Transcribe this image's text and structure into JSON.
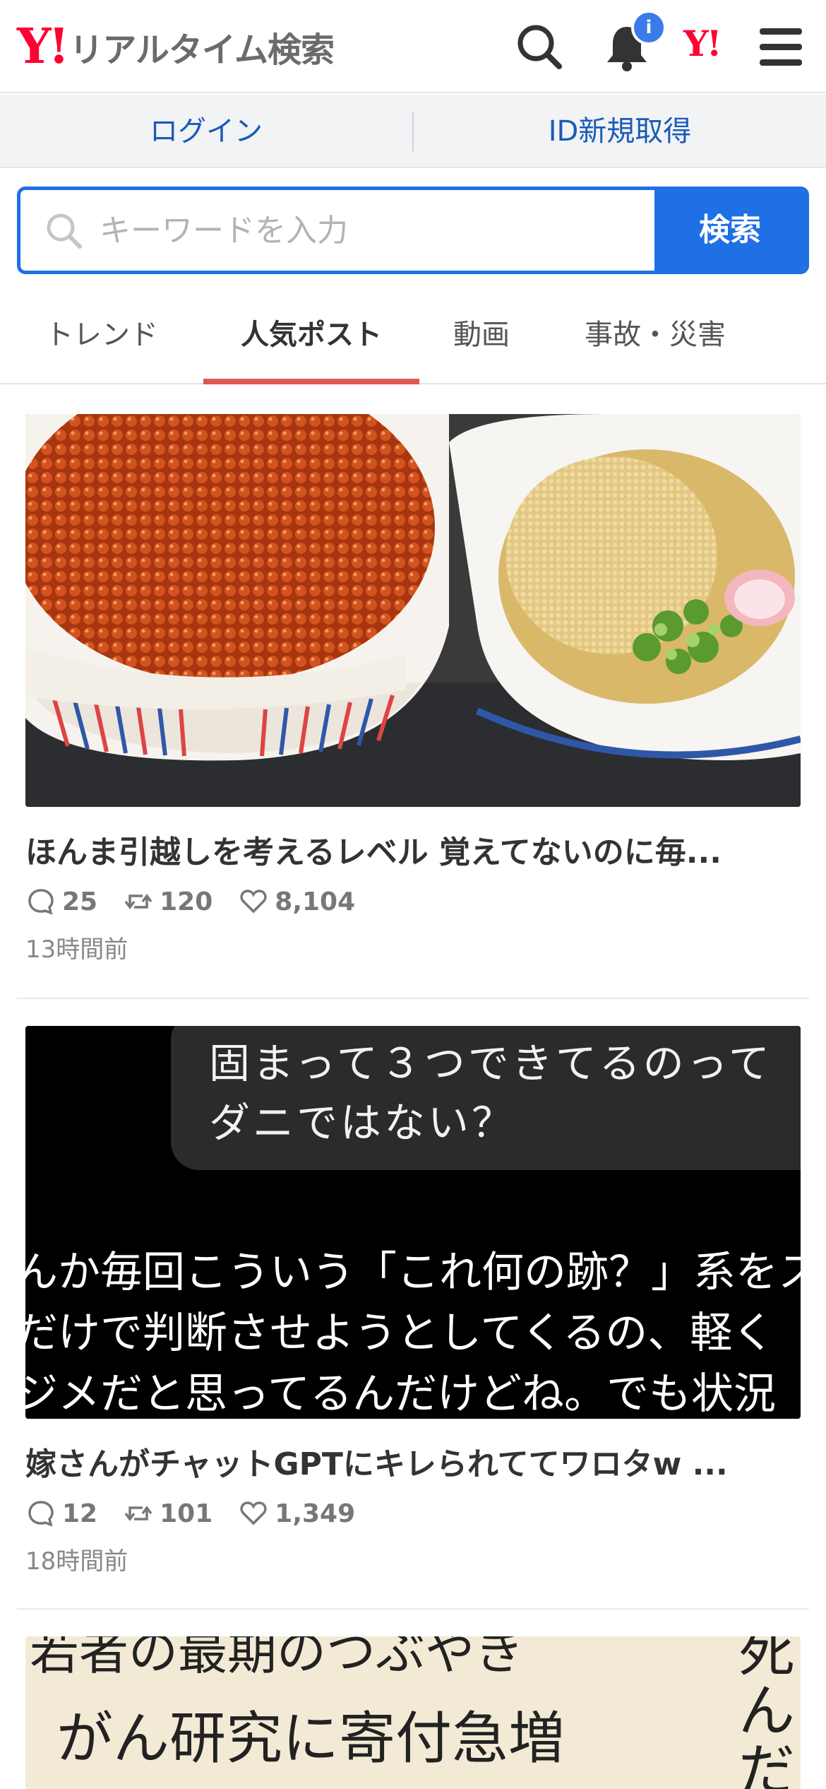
{
  "header": {
    "logo_mark": "Y!",
    "logo_text": "リアルタイム検索",
    "icons": [
      "search-icon",
      "bell-icon",
      "yahoo-logo-icon",
      "menu-icon"
    ],
    "notification_badge": "i",
    "small_logo": "Y!"
  },
  "loginbar": {
    "login_label": "ログイン",
    "signup_label": "ID新規取得"
  },
  "search": {
    "placeholder": "キーワードを入力",
    "value": "",
    "button_label": "検索"
  },
  "tabs": [
    {
      "label": "トレンド",
      "active": false
    },
    {
      "label": "人気ポスト",
      "active": true
    },
    {
      "label": "動画",
      "active": false
    },
    {
      "label": "事故・災害",
      "active": false
    }
  ],
  "posts": [
    {
      "title": "ほんま引越しを考えるレベル 覚えてないのに毎...",
      "replies": "25",
      "reposts": "120",
      "likes": "8,104",
      "time": "13時間前"
    },
    {
      "title": "嫁さんがチャットGPTにキレられててワロタw ...",
      "image_text": {
        "bubble_line1": "固まって３つできてるのって",
        "bubble_line2": "ダニではない？",
        "caption_line1": "んか毎回こういう「これ何の跡？」系をス",
        "caption_line2": "だけで判断させようとしてくるの、軽く",
        "caption_line3": "ジメだと思ってるんだけどね。でも状況"
      },
      "replies": "12",
      "reposts": "101",
      "likes": "1,349",
      "time": "18時間前"
    },
    {
      "image_text": {
        "line1": "若者の最期のつぶやき",
        "line2": "がん研究に寄付急増",
        "side": "死んだ"
      }
    }
  ],
  "colors": {
    "brand_red": "#ff0033",
    "accent_blue": "#1f6fe5",
    "tab_underline": "#e0584f",
    "link_blue": "#1a5bb8"
  }
}
